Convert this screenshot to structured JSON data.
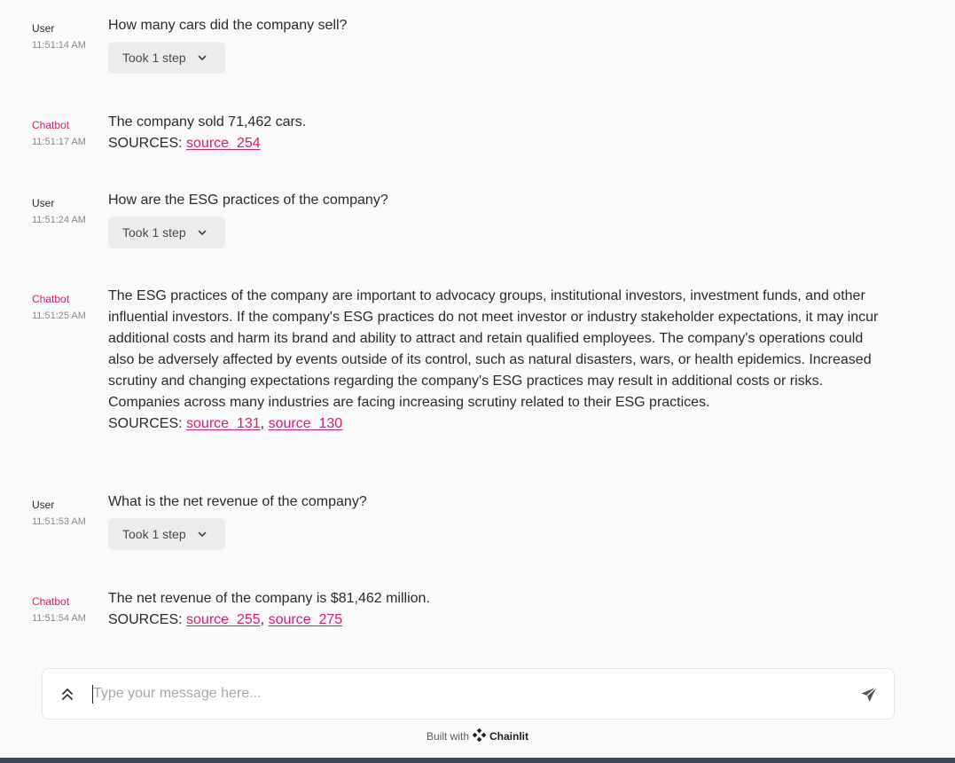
{
  "messages": [
    {
      "author": "User",
      "time": "11:51:14 AM",
      "text": "How many cars did the company sell?",
      "step_label": "Took 1 step"
    },
    {
      "author": "Chatbot",
      "time": "11:51:17 AM",
      "text": "The company sold 71,462 cars.",
      "sources_label": "SOURCES:",
      "sources": [
        "source_254"
      ]
    },
    {
      "author": "User",
      "time": "11:51:24 AM",
      "text": "How are the ESG practices of the company?",
      "step_label": "Took 1 step"
    },
    {
      "author": "Chatbot",
      "time": "11:51:25 AM",
      "text": "The ESG practices of the company are important to advocacy groups, institutional investors, investment funds, and other influential investors. If the company's ESG practices do not meet investor or industry stakeholder expectations, it may incur additional costs and harm its brand and ability to attract and retain qualified employees. The company's operations could also be adversely affected by events outside of its control, such as natural disasters, wars, or health epidemics. Increased scrutiny and changing expectations regarding the company's ESG practices may result in additional costs or risks. Companies across many industries are facing increasing scrutiny related to their ESG practices.",
      "sources_label": "SOURCES:",
      "sources": [
        "source_131",
        "source_130"
      ]
    },
    {
      "author": "User",
      "time": "11:51:53 AM",
      "text": "What is the net revenue of the company?",
      "step_label": "Took 1 step"
    },
    {
      "author": "Chatbot",
      "time": "11:51:54 AM",
      "text": "The net revenue of the company is $81,462 million.",
      "sources_label": "SOURCES:",
      "sources": [
        "source_255",
        "source_275"
      ]
    }
  ],
  "composer": {
    "placeholder": "Type your message here..."
  },
  "footer": {
    "built_with": "Built with",
    "brand": "Chainlit"
  },
  "colors": {
    "accent": "#e3186f",
    "background": "#fafafa",
    "step_button": "#ececec"
  },
  "icons": {
    "expand": "double-chevron-up-icon",
    "send": "paper-plane-icon",
    "step_toggle": "chevron-down-icon",
    "brand_logo": "chainlit-logo-icon"
  }
}
